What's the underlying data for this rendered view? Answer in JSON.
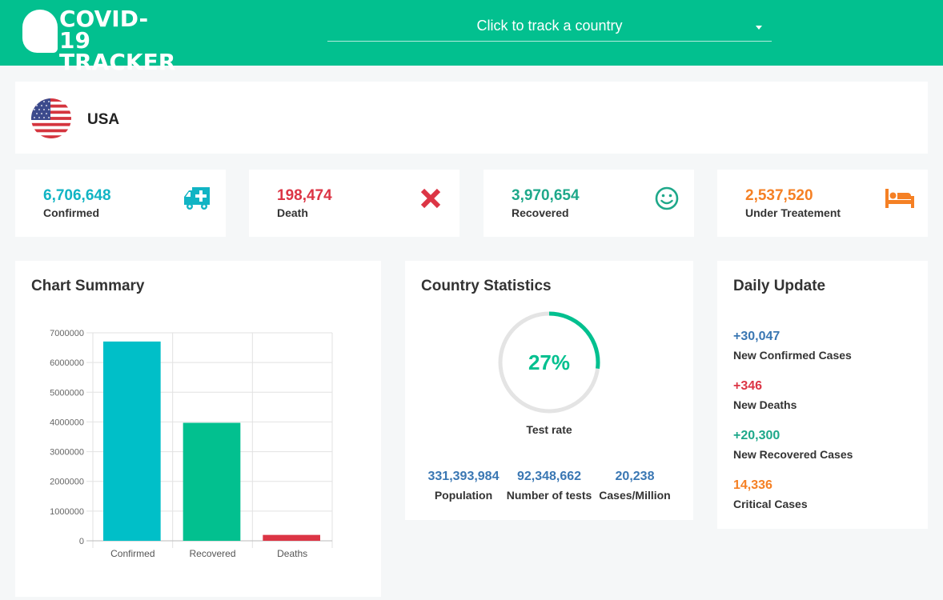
{
  "header": {
    "logo_line1": "COVID-19",
    "logo_line2": "TRACKER",
    "select_label": "Click to track a country",
    "brand_color": "#02c08f"
  },
  "country": {
    "name": "USA",
    "flag_icon": "usa-flag-icon"
  },
  "stats": [
    {
      "value": "6,706,648",
      "label": "Confirmed",
      "color": "#11b4c4",
      "icon": "ambulance-icon"
    },
    {
      "value": "198,474",
      "label": "Death",
      "color": "#dc3545",
      "icon": "close-x-icon"
    },
    {
      "value": "3,970,654",
      "label": "Recovered",
      "color": "#1ea88a",
      "icon": "smile-icon"
    },
    {
      "value": "2,537,520",
      "label": "Under Treatement",
      "color": "#f58024",
      "icon": "bed-icon"
    }
  ],
  "chart_panel": {
    "title": "Chart Summary"
  },
  "chart_data": {
    "type": "bar",
    "categories": [
      "Confirmed",
      "Recovered",
      "Deaths"
    ],
    "values": [
      6706648,
      3970654,
      198474
    ],
    "colors": [
      "#00bfc8",
      "#02c08f",
      "#dc3545"
    ],
    "ylim": [
      0,
      7000000
    ],
    "yticks": [
      "7000000",
      "6000000",
      "5000000",
      "4000000",
      "3000000",
      "2000000",
      "1000000",
      "0"
    ],
    "grid": true
  },
  "country_stats": {
    "title": "Country Statistics",
    "test_rate_value": "27%",
    "test_rate_fraction": 0.27,
    "test_rate_label": "Test rate",
    "items": [
      {
        "value": "331,393,984",
        "label": "Population"
      },
      {
        "value": "92,348,662",
        "label": "Number of tests"
      },
      {
        "value": "20,238",
        "label": "Cases/Million"
      }
    ]
  },
  "daily": {
    "title": "Daily Update",
    "items": [
      {
        "value": "+30,047",
        "label": "New Confirmed Cases",
        "color": "#3a77b3"
      },
      {
        "value": "+346",
        "label": "New Deaths",
        "color": "#dc3545"
      },
      {
        "value": "+20,300",
        "label": "New Recovered Cases",
        "color": "#1ea88a"
      },
      {
        "value": "14,336",
        "label": "Critical Cases",
        "color": "#f58024"
      }
    ]
  }
}
